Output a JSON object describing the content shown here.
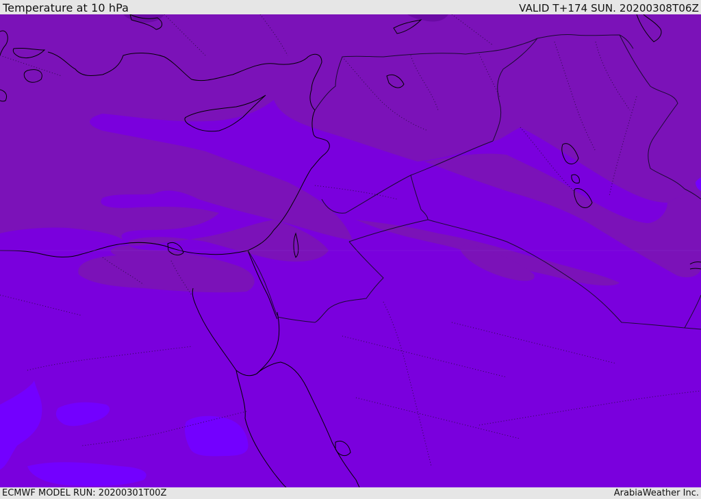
{
  "header": {
    "title": "Temperature at 10 hPa",
    "valid": "VALID T+174 SUN. 20200308T06Z"
  },
  "footer": {
    "model_run": "ECMWF MODEL RUN: 20200301T00Z",
    "credit": "ArabiaWeather Inc."
  },
  "map": {
    "colors": {
      "base_field": "#7a00dd",
      "warm_band": "#7b12b8",
      "darkest_band": "#6a0aa4",
      "cold_patch": "#7300ff",
      "coastline": "#000000",
      "border": "#1a0a30"
    },
    "layers": [
      "temperature-field",
      "coastlines",
      "country-borders",
      "province-borders"
    ]
  }
}
